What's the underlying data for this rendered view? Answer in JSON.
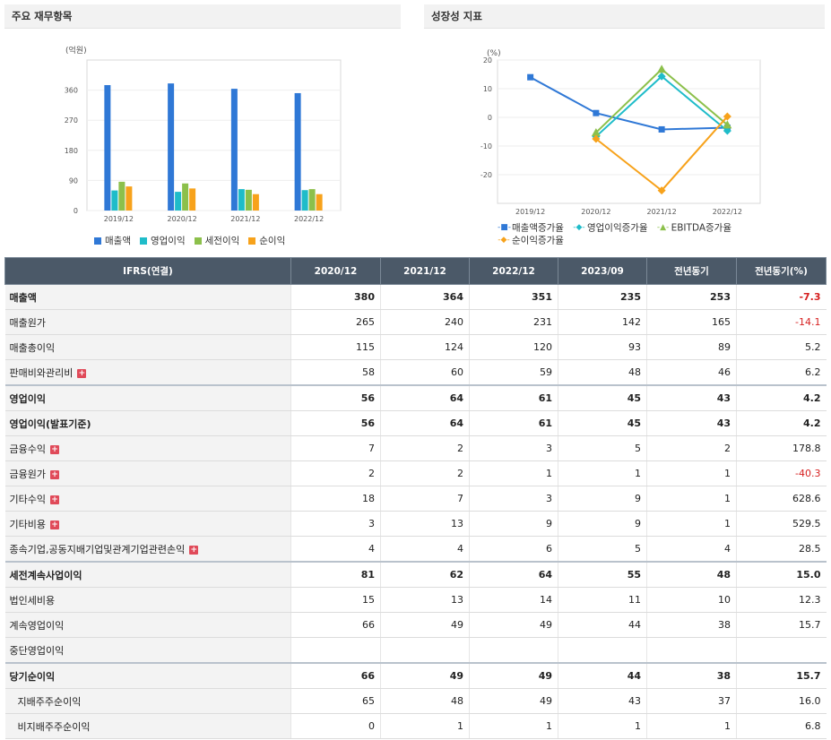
{
  "left_panel": {
    "title": "주요 재무항목"
  },
  "right_panel": {
    "title": "성장성 지표"
  },
  "chart_data": [
    {
      "type": "bar",
      "title": "주요 재무항목",
      "ylabel": "(억원)",
      "categories": [
        "2019/12",
        "2020/12",
        "2021/12",
        "2022/12"
      ],
      "y_ticks": [
        "0",
        "90",
        "180",
        "270",
        "360"
      ],
      "ylim": [
        0,
        450
      ],
      "grid": true,
      "legend_position": "bottom",
      "series": [
        {
          "name": "매출액",
          "color": "#2f78d6",
          "values": [
            375,
            380,
            364,
            351
          ]
        },
        {
          "name": "영업이익",
          "color": "#1fbcc9",
          "values": [
            60,
            56,
            64,
            61
          ]
        },
        {
          "name": "세전이익",
          "color": "#8cc04b",
          "values": [
            86,
            81,
            62,
            64
          ]
        },
        {
          "name": "순이익",
          "color": "#f7a21b",
          "values": [
            72,
            66,
            49,
            49
          ]
        }
      ]
    },
    {
      "type": "line",
      "title": "성장성 지표",
      "ylabel": "(%)",
      "categories": [
        "2019/12",
        "2020/12",
        "2021/12",
        "2022/12"
      ],
      "y_ticks": [
        "20",
        "10",
        "0",
        "-10",
        "-20"
      ],
      "ylim": [
        -30,
        20
      ],
      "grid": true,
      "legend_position": "bottom",
      "series": [
        {
          "name": "매출액증가율",
          "color": "#2f78d6",
          "marker": "square",
          "values": [
            14,
            1.5,
            -4.2,
            -3.6
          ]
        },
        {
          "name": "영업이익증가율",
          "color": "#1fbcc9",
          "marker": "diamond",
          "values": [
            null,
            -6.7,
            14.3,
            -4.7
          ]
        },
        {
          "name": "EBITDA증가율",
          "color": "#8cc04b",
          "marker": "triangle",
          "values": [
            null,
            -5.3,
            16.8,
            -2.6
          ]
        },
        {
          "name": "순이익증가율",
          "color": "#f7a21b",
          "marker": "diamond",
          "values": [
            null,
            -7.5,
            -25.5,
            0.3
          ]
        }
      ]
    }
  ],
  "table": {
    "headers": [
      "IFRS(연결)",
      "2020/12",
      "2021/12",
      "2022/12",
      "2023/09",
      "전년동기",
      "전년동기(%)"
    ],
    "rows": [
      {
        "label": "매출액",
        "values": [
          "380",
          "364",
          "351",
          "235",
          "253",
          "-7.3"
        ],
        "bold": true,
        "expandable": false,
        "negative_last": true
      },
      {
        "label": "매출원가",
        "values": [
          "265",
          "240",
          "231",
          "142",
          "165",
          "-14.1"
        ],
        "bold": false,
        "expandable": false,
        "negative_last": true
      },
      {
        "label": "매출총이익",
        "values": [
          "115",
          "124",
          "120",
          "93",
          "89",
          "5.2"
        ],
        "bold": false,
        "expandable": false,
        "negative_last": false
      },
      {
        "label": "판매비와관리비",
        "values": [
          "58",
          "60",
          "59",
          "48",
          "46",
          "6.2"
        ],
        "bold": false,
        "expandable": true,
        "negative_last": false
      },
      {
        "label": "영업이익",
        "values": [
          "56",
          "64",
          "61",
          "45",
          "43",
          "4.2"
        ],
        "bold": true,
        "expandable": false,
        "negative_last": false,
        "sep": true
      },
      {
        "label": "영업이익(발표기준)",
        "values": [
          "56",
          "64",
          "61",
          "45",
          "43",
          "4.2"
        ],
        "bold": true,
        "expandable": false,
        "negative_last": false
      },
      {
        "label": "금융수익",
        "values": [
          "7",
          "2",
          "3",
          "5",
          "2",
          "178.8"
        ],
        "bold": false,
        "expandable": true,
        "negative_last": false
      },
      {
        "label": "금융원가",
        "values": [
          "2",
          "2",
          "1",
          "1",
          "1",
          "-40.3"
        ],
        "bold": false,
        "expandable": true,
        "negative_last": true
      },
      {
        "label": "기타수익",
        "values": [
          "18",
          "7",
          "3",
          "9",
          "1",
          "628.6"
        ],
        "bold": false,
        "expandable": true,
        "negative_last": false
      },
      {
        "label": "기타비용",
        "values": [
          "3",
          "13",
          "9",
          "9",
          "1",
          "529.5"
        ],
        "bold": false,
        "expandable": true,
        "negative_last": false
      },
      {
        "label": "종속기업,공동지배기업및관계기업관련손익",
        "values": [
          "4",
          "4",
          "6",
          "5",
          "4",
          "28.5"
        ],
        "bold": false,
        "expandable": true,
        "negative_last": false
      },
      {
        "label": "세전계속사업이익",
        "values": [
          "81",
          "62",
          "64",
          "55",
          "48",
          "15.0"
        ],
        "bold": true,
        "expandable": false,
        "negative_last": false,
        "sep": true
      },
      {
        "label": "법인세비용",
        "values": [
          "15",
          "13",
          "14",
          "11",
          "10",
          "12.3"
        ],
        "bold": false,
        "expandable": false,
        "negative_last": false
      },
      {
        "label": "계속영업이익",
        "values": [
          "66",
          "49",
          "49",
          "44",
          "38",
          "15.7"
        ],
        "bold": false,
        "expandable": false,
        "negative_last": false
      },
      {
        "label": "중단영업이익",
        "values": [
          "",
          "",
          "",
          "",
          "",
          ""
        ],
        "bold": false,
        "expandable": false,
        "negative_last": false
      },
      {
        "label": "당기순이익",
        "values": [
          "66",
          "49",
          "49",
          "44",
          "38",
          "15.7"
        ],
        "bold": true,
        "expandable": false,
        "negative_last": false,
        "sep": true
      },
      {
        "label": "지배주주순이익",
        "values": [
          "65",
          "48",
          "49",
          "43",
          "37",
          "16.0"
        ],
        "bold": false,
        "expandable": false,
        "negative_last": false,
        "indent": true
      },
      {
        "label": "비지배주주순이익",
        "values": [
          "0",
          "1",
          "1",
          "1",
          "1",
          "6.8"
        ],
        "bold": false,
        "expandable": false,
        "negative_last": false,
        "indent": true
      }
    ]
  }
}
